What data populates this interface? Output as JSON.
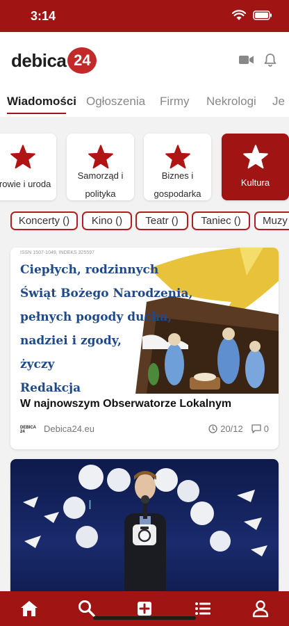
{
  "status": {
    "time": "3:14"
  },
  "header": {
    "logo_text": "debica",
    "logo_badge": "24"
  },
  "tabs": [
    {
      "label": "Wiadomości",
      "active": true
    },
    {
      "label": "Ogłoszenia"
    },
    {
      "label": "Firmy"
    },
    {
      "label": "Nekrologi"
    },
    {
      "label": "Je"
    }
  ],
  "categories": [
    {
      "line1": "drowie i uroda",
      "line2": "",
      "icon": "star-icon"
    },
    {
      "line1": "Samorząd i",
      "line2": "polityka",
      "icon": "star-icon"
    },
    {
      "line1": "Biznes i",
      "line2": "gospodarka",
      "icon": "star-icon"
    },
    {
      "line1": "Kultura",
      "line2": "",
      "icon": "star-icon",
      "active": true
    }
  ],
  "chips": [
    "Koncerty ()",
    "Kino ()",
    "Teatr ()",
    "Taniec ()",
    "Muzy"
  ],
  "articles": [
    {
      "image_text": {
        "fine": "ISSN 1507-1049, INDEKS 325597",
        "lines": [
          "Ciepłych, rodzinnych",
          "Świąt Bożego Narodzenia,",
          "pełnych pogody ducha,",
          "nadziei i zgody,",
          "życzy",
          "Redakcja"
        ]
      },
      "title": "W najnowszym Obserwatorze Lokalnym",
      "source_logo": "DEBICA 24",
      "source": "Debica24.eu",
      "date": "20/12",
      "comments": "0"
    },
    {
      "image": "stage-photo"
    }
  ],
  "colors": {
    "brand": "#a11414",
    "accent_blue": "#1e4a8a",
    "star": "#b01414"
  },
  "bottom_nav": [
    "home-icon",
    "search-icon",
    "add-icon",
    "list-icon",
    "profile-icon"
  ]
}
